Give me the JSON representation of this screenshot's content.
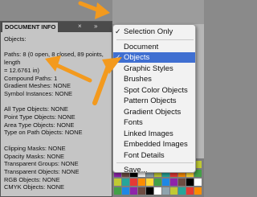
{
  "panel": {
    "tab_label": "DOCUMENT INFO",
    "tab_close": "×",
    "collapse": "»",
    "lines": [
      "Objects:",
      "",
      "Paths: 8 (0 open, 8 closed, 89 points, length",
      "= 12.6761 in)",
      "Compound Paths: 1",
      "Gradient Meshes: NONE",
      "Symbol Instances: NONE",
      "",
      "All Type Objects: NONE",
      "Point Type Objects: NONE",
      "Area Type Objects: NONE",
      "Type on Path Objects: NONE",
      "",
      "Clipping Masks: NONE",
      "Opacity Masks: NONE",
      "Transparent Groups: NONE",
      "Transparent Objects: NONE",
      "RGB Objects: NONE",
      "CMYK Objects: NONE"
    ]
  },
  "menu": {
    "items": [
      {
        "label": "Selection Only",
        "check": "✓",
        "selected": false
      },
      {
        "label": "Document",
        "check": "",
        "selected": false
      },
      {
        "label": "Objects",
        "check": "✓",
        "selected": true
      },
      {
        "label": "Graphic Styles",
        "check": "",
        "selected": false
      },
      {
        "label": "Brushes",
        "check": "",
        "selected": false
      },
      {
        "label": "Spot Color Objects",
        "check": "",
        "selected": false
      },
      {
        "label": "Pattern Objects",
        "check": "",
        "selected": false
      },
      {
        "label": "Gradient Objects",
        "check": "",
        "selected": false
      },
      {
        "label": "Fonts",
        "check": "",
        "selected": false
      },
      {
        "label": "Linked Images",
        "check": "",
        "selected": false
      },
      {
        "label": "Embedded Images",
        "check": "",
        "selected": false
      },
      {
        "label": "Font Details",
        "check": "",
        "selected": false
      },
      {
        "label": "Save...",
        "check": "",
        "selected": false
      }
    ]
  },
  "colors": {
    "accent": "#3f6fd1",
    "arrow": "#f39a1e"
  },
  "icons": {
    "menu_check": "checkmark-icon",
    "panel_close": "close-icon",
    "panel_collapse": "collapse-icon"
  }
}
